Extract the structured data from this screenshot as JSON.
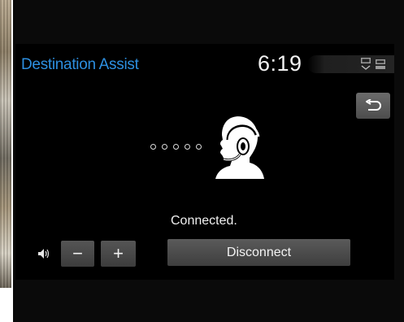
{
  "header": {
    "title": "Destination Assist",
    "clock": "6:19",
    "status_icons": [
      "dcm-icon",
      "dcm-icon"
    ]
  },
  "main": {
    "back_icon": "back-arrow-icon",
    "agent_icon": "headset-operator-icon",
    "connecting_dots": 5,
    "status_text": "Connected."
  },
  "controls": {
    "volume_icon": "speaker-icon",
    "volume_down_label": "−",
    "volume_up_label": "+",
    "disconnect_label": "Disconnect"
  },
  "colors": {
    "title": "#2d8fe0",
    "screen_bg": "#000000",
    "button": "#4a4a4a"
  }
}
